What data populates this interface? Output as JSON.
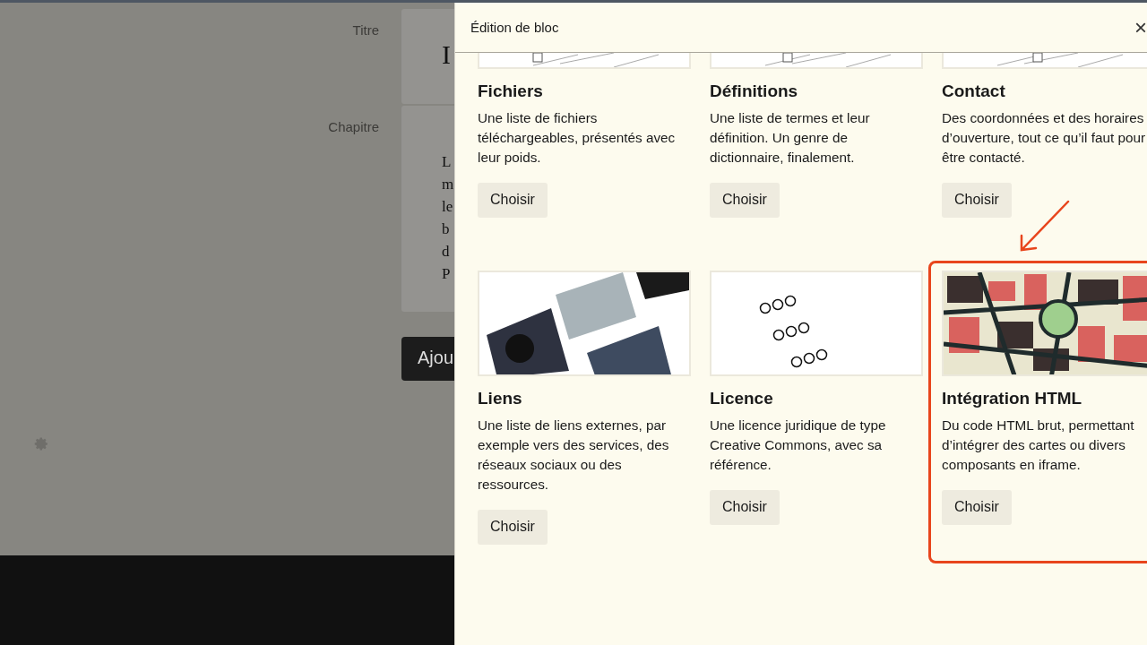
{
  "page": {
    "fields": [
      {
        "label": "Titre",
        "value_lines": [
          "I"
        ]
      },
      {
        "label": "Chapitre",
        "value_lines": [
          "L",
          "m",
          "le",
          "b",
          "d",
          "P"
        ]
      }
    ],
    "add_button": "Ajou"
  },
  "panel": {
    "title": "Édition de bloc",
    "close": "×",
    "blocks": [
      {
        "title": "Fichiers",
        "description": "Une liste de fichiers téléchargeables, présentés avec leur poids.",
        "button": "Choisir",
        "highlighted": false
      },
      {
        "title": "Définitions",
        "description": "Une liste de termes et leur définition. Un genre de dictionnaire, finalement.",
        "button": "Choisir",
        "highlighted": false
      },
      {
        "title": "Contact",
        "description": "Des coordonnées et des horaires d’ouverture, tout ce qu’il faut pour être contacté.",
        "button": "Choisir",
        "highlighted": false
      },
      {
        "title": "Liens",
        "description": "Une liste de liens externes, par exemple vers des services, des réseaux sociaux ou des ressources.",
        "button": "Choisir",
        "highlighted": false
      },
      {
        "title": "Licence",
        "description": "Une licence juridique de type Creative Commons, avec sa référence.",
        "button": "Choisir",
        "highlighted": false
      },
      {
        "title": "Intégration HTML",
        "description": "Du code HTML brut, permettant d’intégrer des cartes ou divers composants en iframe.",
        "button": "Choisir",
        "highlighted": true
      }
    ]
  }
}
